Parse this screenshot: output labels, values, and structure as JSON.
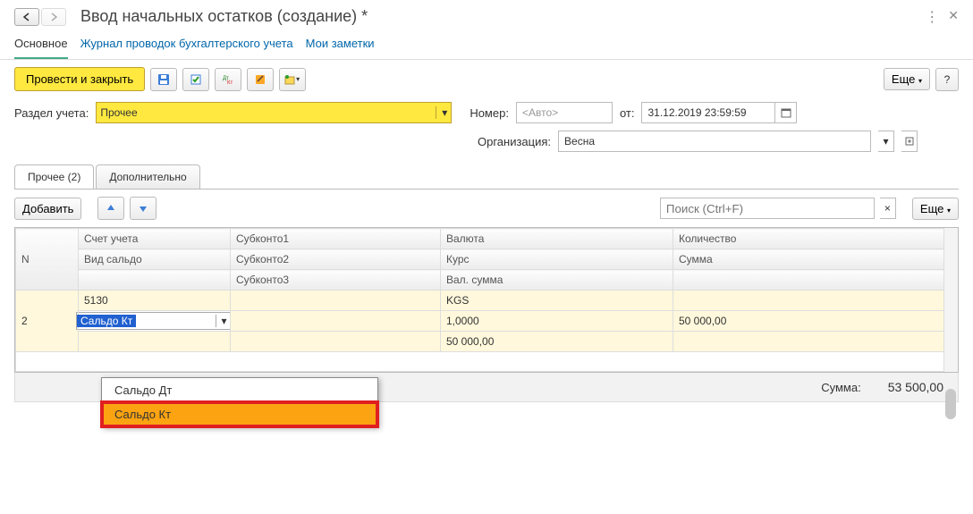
{
  "header": {
    "title": "Ввод начальных остатков (создание) *"
  },
  "subnav": {
    "main": "Основное",
    "journal": "Журнал проводок бухгалтерского учета",
    "notes": "Мои заметки"
  },
  "toolbar": {
    "submit": "Провести и закрыть",
    "more": "Еще"
  },
  "form": {
    "section_label": "Раздел учета:",
    "section_value": "Прочее",
    "number_label": "Номер:",
    "number_placeholder": "<Авто>",
    "from_label": "от:",
    "date_value": "31.12.2019 23:59:59",
    "org_label": "Организация:",
    "org_value": "Весна"
  },
  "tabs": {
    "t1": "Прочее (2)",
    "t2": "Дополнительно"
  },
  "gridtb": {
    "add": "Добавить",
    "search_placeholder": "Поиск (Ctrl+F)",
    "more": "Еще"
  },
  "headers": {
    "n": "N",
    "acc": "Счет учета",
    "sub1": "Субконто1",
    "cur": "Валюта",
    "qty": "Количество",
    "saldo": "Вид сальдо",
    "sub2": "Субконто2",
    "rate": "Курс",
    "sum": "Сумма",
    "sub3": "Субконто3",
    "valsum": "Вал. сумма"
  },
  "row": {
    "n": "2",
    "acc": "5130",
    "cur": "KGS",
    "editing": "Сальдо Кт",
    "rate": "1,0000",
    "amount": "50 000,00",
    "valsum": "50 000,00"
  },
  "dropdown": {
    "opt1": "Сальдо Дт",
    "opt2": "Сальдо Кт"
  },
  "footer": {
    "label": "Сумма:",
    "value": "53 500,00"
  }
}
